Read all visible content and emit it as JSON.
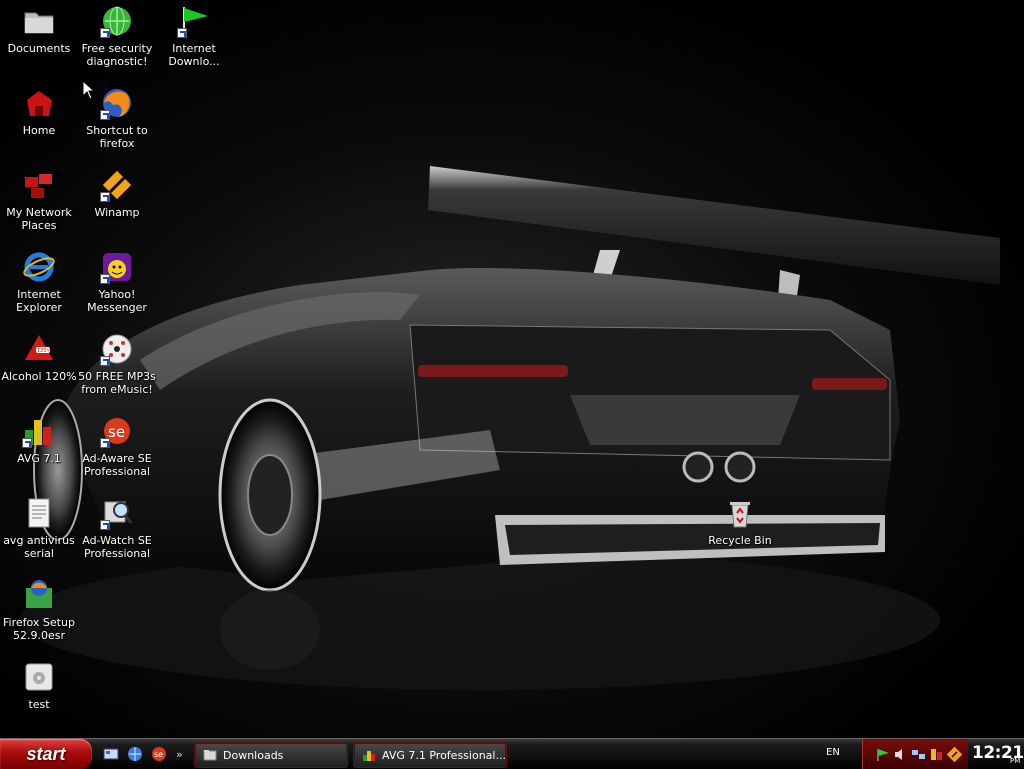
{
  "desktop": {
    "icons": [
      {
        "label": "Documents",
        "icon": "folder-icon"
      },
      {
        "label": "Free security diagnostic!",
        "icon": "globe-icon",
        "shortcut": true
      },
      {
        "label": "Internet Downlo...",
        "icon": "green-flag-icon",
        "shortcut": true
      },
      {
        "label": "Home",
        "icon": "home-icon"
      },
      {
        "label": "Shortcut to firefox",
        "icon": "firefox-icon",
        "shortcut": true
      },
      {
        "label": "My Network Places",
        "icon": "network-places-icon"
      },
      {
        "label": "Winamp",
        "icon": "winamp-icon",
        "shortcut": true
      },
      {
        "label": "Internet Explorer",
        "icon": "internet-explorer-icon"
      },
      {
        "label": "Yahoo! Messenger",
        "icon": "yahoo-messenger-icon",
        "shortcut": true
      },
      {
        "label": "Alcohol 120%",
        "icon": "alcohol-icon"
      },
      {
        "label": "50 FREE MP3s from eMusic!",
        "icon": "cd-icon",
        "shortcut": true
      },
      {
        "label": "AVG 7.1",
        "icon": "avg-icon",
        "shortcut": true
      },
      {
        "label": "Ad-Aware SE Professional",
        "icon": "ad-aware-icon",
        "shortcut": true
      },
      {
        "label": "avg antivirus serial",
        "icon": "text-document-icon"
      },
      {
        "label": "Ad-Watch SE Professional",
        "icon": "ad-watch-icon",
        "shortcut": true
      },
      {
        "label": "Firefox Setup 52.9.0esr",
        "icon": "installer-icon"
      },
      {
        "label": "test",
        "icon": "settings-file-icon"
      },
      {
        "label": "Recycle Bin",
        "icon": "recycle-bin-icon"
      }
    ]
  },
  "taskbar": {
    "start_label": "start",
    "quick_launch": [
      "show-desktop-icon",
      "browser-icon",
      "ad-aware-icon"
    ],
    "quick_launch_more": "»",
    "tasks": [
      {
        "label": "Downloads",
        "icon": "folder-icon"
      },
      {
        "label": "AVG 7.1 Professional...",
        "icon": "avg-icon"
      }
    ],
    "language": "EN",
    "tray_icons": [
      "green-flag-icon",
      "speaker-icon",
      "network-icon",
      "security-icon",
      "winamp-icon"
    ],
    "clock": {
      "time": "12:21",
      "ampm": "PM"
    }
  },
  "colors": {
    "taskbar": "#0f0f0f",
    "start": "#a80c0c",
    "tray": "#7a0d0d"
  }
}
